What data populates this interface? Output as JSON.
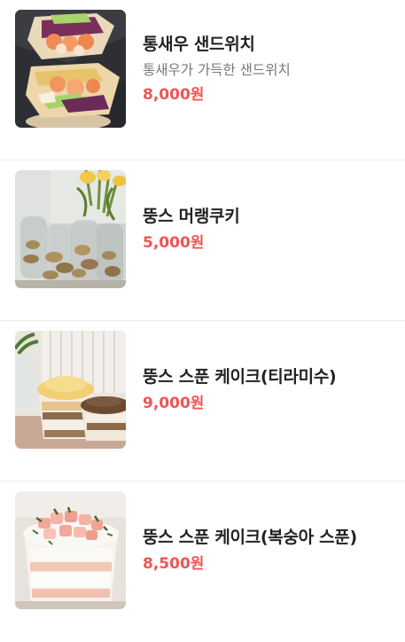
{
  "colors": {
    "price": "#f05454",
    "name": "#222222",
    "description": "#777777",
    "divider": "#ececec"
  },
  "menu": {
    "items": [
      {
        "image_icon": "sandwich-photo",
        "name": "통새우 샌드위치",
        "description": "통새우가 가득한 샌드위치",
        "price": "8,000원"
      },
      {
        "image_icon": "meringue-cookie-photo",
        "name": "뚱스 머랭쿠키",
        "price": "5,000원"
      },
      {
        "image_icon": "tiramisu-cake-photo",
        "name": "뚱스 스푼 케이크(티라미수)",
        "price": "9,000원"
      },
      {
        "image_icon": "peach-cake-photo",
        "name": "뚱스 스푼 케이크(복숭아 스푼)",
        "price": "8,500원"
      }
    ]
  }
}
